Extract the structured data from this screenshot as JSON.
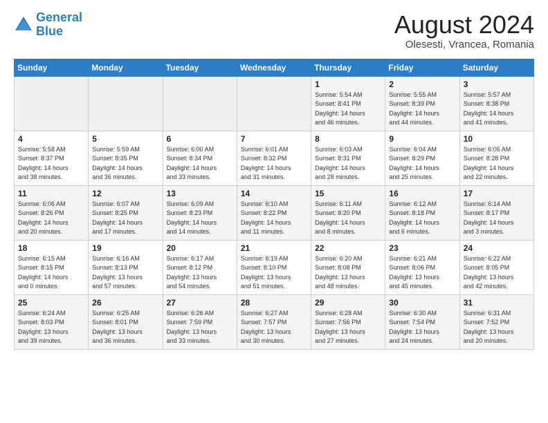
{
  "header": {
    "logo_line1": "General",
    "logo_line2": "Blue",
    "month_year": "August 2024",
    "location": "Olesesti, Vrancea, Romania"
  },
  "days_of_week": [
    "Sunday",
    "Monday",
    "Tuesday",
    "Wednesday",
    "Thursday",
    "Friday",
    "Saturday"
  ],
  "weeks": [
    [
      {
        "day": "",
        "info": ""
      },
      {
        "day": "",
        "info": ""
      },
      {
        "day": "",
        "info": ""
      },
      {
        "day": "",
        "info": ""
      },
      {
        "day": "1",
        "info": "Sunrise: 5:54 AM\nSunset: 8:41 PM\nDaylight: 14 hours\nand 46 minutes."
      },
      {
        "day": "2",
        "info": "Sunrise: 5:55 AM\nSunset: 8:39 PM\nDaylight: 14 hours\nand 44 minutes."
      },
      {
        "day": "3",
        "info": "Sunrise: 5:57 AM\nSunset: 8:38 PM\nDaylight: 14 hours\nand 41 minutes."
      }
    ],
    [
      {
        "day": "4",
        "info": "Sunrise: 5:58 AM\nSunset: 8:37 PM\nDaylight: 14 hours\nand 38 minutes."
      },
      {
        "day": "5",
        "info": "Sunrise: 5:59 AM\nSunset: 8:35 PM\nDaylight: 14 hours\nand 36 minutes."
      },
      {
        "day": "6",
        "info": "Sunrise: 6:00 AM\nSunset: 8:34 PM\nDaylight: 14 hours\nand 33 minutes."
      },
      {
        "day": "7",
        "info": "Sunrise: 6:01 AM\nSunset: 8:32 PM\nDaylight: 14 hours\nand 31 minutes."
      },
      {
        "day": "8",
        "info": "Sunrise: 6:03 AM\nSunset: 8:31 PM\nDaylight: 14 hours\nand 28 minutes."
      },
      {
        "day": "9",
        "info": "Sunrise: 6:04 AM\nSunset: 8:29 PM\nDaylight: 14 hours\nand 25 minutes."
      },
      {
        "day": "10",
        "info": "Sunrise: 6:05 AM\nSunset: 8:28 PM\nDaylight: 14 hours\nand 22 minutes."
      }
    ],
    [
      {
        "day": "11",
        "info": "Sunrise: 6:06 AM\nSunset: 8:26 PM\nDaylight: 14 hours\nand 20 minutes."
      },
      {
        "day": "12",
        "info": "Sunrise: 6:07 AM\nSunset: 8:25 PM\nDaylight: 14 hours\nand 17 minutes."
      },
      {
        "day": "13",
        "info": "Sunrise: 6:09 AM\nSunset: 8:23 PM\nDaylight: 14 hours\nand 14 minutes."
      },
      {
        "day": "14",
        "info": "Sunrise: 6:10 AM\nSunset: 8:22 PM\nDaylight: 14 hours\nand 11 minutes."
      },
      {
        "day": "15",
        "info": "Sunrise: 6:11 AM\nSunset: 8:20 PM\nDaylight: 14 hours\nand 8 minutes."
      },
      {
        "day": "16",
        "info": "Sunrise: 6:12 AM\nSunset: 8:18 PM\nDaylight: 14 hours\nand 6 minutes."
      },
      {
        "day": "17",
        "info": "Sunrise: 6:14 AM\nSunset: 8:17 PM\nDaylight: 14 hours\nand 3 minutes."
      }
    ],
    [
      {
        "day": "18",
        "info": "Sunrise: 6:15 AM\nSunset: 8:15 PM\nDaylight: 14 hours\nand 0 minutes."
      },
      {
        "day": "19",
        "info": "Sunrise: 6:16 AM\nSunset: 8:13 PM\nDaylight: 13 hours\nand 57 minutes."
      },
      {
        "day": "20",
        "info": "Sunrise: 6:17 AM\nSunset: 8:12 PM\nDaylight: 13 hours\nand 54 minutes."
      },
      {
        "day": "21",
        "info": "Sunrise: 6:19 AM\nSunset: 8:10 PM\nDaylight: 13 hours\nand 51 minutes."
      },
      {
        "day": "22",
        "info": "Sunrise: 6:20 AM\nSunset: 8:08 PM\nDaylight: 13 hours\nand 48 minutes."
      },
      {
        "day": "23",
        "info": "Sunrise: 6:21 AM\nSunset: 8:06 PM\nDaylight: 13 hours\nand 45 minutes."
      },
      {
        "day": "24",
        "info": "Sunrise: 6:22 AM\nSunset: 8:05 PM\nDaylight: 13 hours\nand 42 minutes."
      }
    ],
    [
      {
        "day": "25",
        "info": "Sunrise: 6:24 AM\nSunset: 8:03 PM\nDaylight: 13 hours\nand 39 minutes."
      },
      {
        "day": "26",
        "info": "Sunrise: 6:25 AM\nSunset: 8:01 PM\nDaylight: 13 hours\nand 36 minutes."
      },
      {
        "day": "27",
        "info": "Sunrise: 6:26 AM\nSunset: 7:59 PM\nDaylight: 13 hours\nand 33 minutes."
      },
      {
        "day": "28",
        "info": "Sunrise: 6:27 AM\nSunset: 7:57 PM\nDaylight: 13 hours\nand 30 minutes."
      },
      {
        "day": "29",
        "info": "Sunrise: 6:28 AM\nSunset: 7:56 PM\nDaylight: 13 hours\nand 27 minutes."
      },
      {
        "day": "30",
        "info": "Sunrise: 6:30 AM\nSunset: 7:54 PM\nDaylight: 13 hours\nand 24 minutes."
      },
      {
        "day": "31",
        "info": "Sunrise: 6:31 AM\nSunset: 7:52 PM\nDaylight: 13 hours\nand 20 minutes."
      }
    ]
  ]
}
